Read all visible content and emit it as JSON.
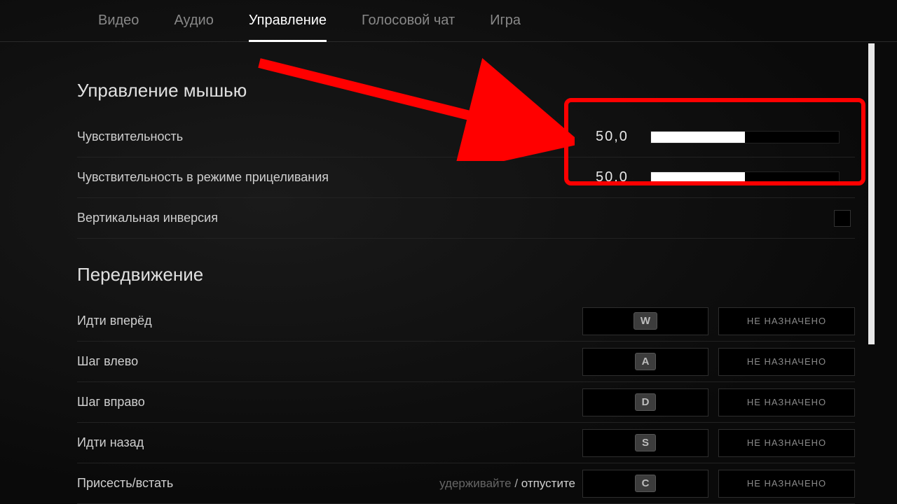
{
  "tabs": {
    "items": [
      {
        "label": "Видео",
        "active": false
      },
      {
        "label": "Аудио",
        "active": false
      },
      {
        "label": "Управление",
        "active": true
      },
      {
        "label": "Голосовой чат",
        "active": false
      },
      {
        "label": "Игра",
        "active": false
      }
    ]
  },
  "sections": {
    "mouse": {
      "title": "Управление мышью",
      "sensitivity": {
        "label": "Чувствительность",
        "value": "50,0",
        "percent": 50
      },
      "ads_sensitivity": {
        "label": "Чувствительность в режиме прицеливания",
        "value": "50,0",
        "percent": 50
      },
      "invert_y": {
        "label": "Вертикальная инверсия",
        "checked": false
      }
    },
    "movement": {
      "title": "Передвижение",
      "unassigned_label": "НЕ НАЗНАЧЕНО",
      "hint_hold": "удерживайте",
      "hint_sep": "/",
      "hint_release": "отпустите",
      "rows": [
        {
          "label": "Идти вперёд",
          "key": "W"
        },
        {
          "label": "Шаг влево",
          "key": "A"
        },
        {
          "label": "Шаг вправо",
          "key": "D"
        },
        {
          "label": "Идти назад",
          "key": "S"
        },
        {
          "label": "Присесть/встать",
          "key": "C",
          "has_hint": true
        }
      ]
    }
  }
}
